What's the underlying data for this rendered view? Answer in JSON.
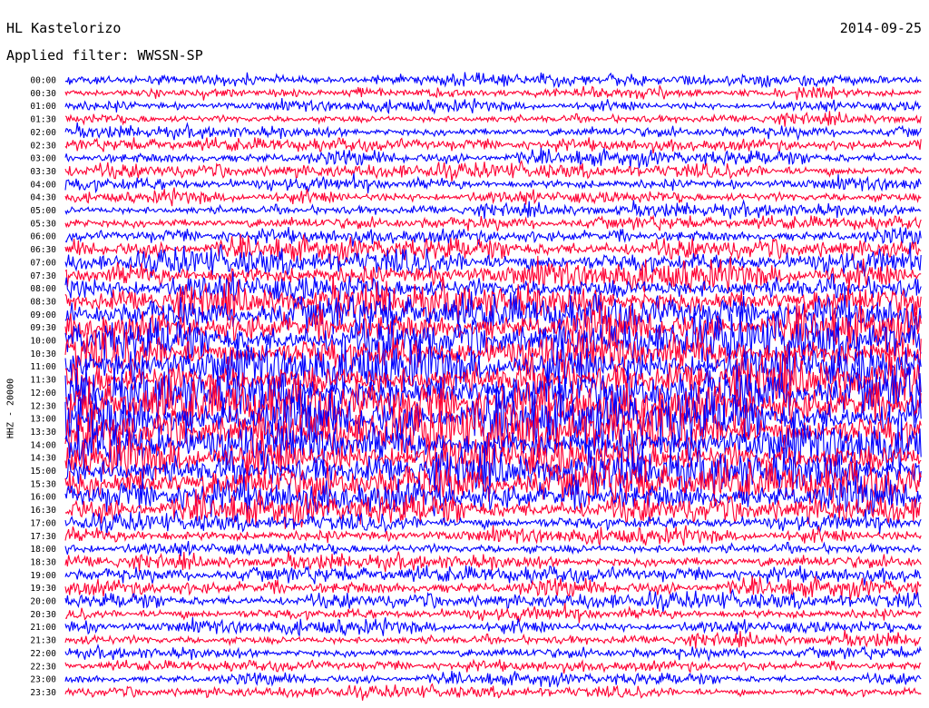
{
  "header": {
    "station": "HL Kastelorizo",
    "date": "2014-09-25",
    "filter": "Applied filter: WWSSN-SP"
  },
  "chart_data": {
    "type": "line",
    "title": "HL Kastelorizo",
    "ylabel": "HHZ - 20000",
    "colors": [
      "#0000ff",
      "#ff0033"
    ],
    "rows": [
      {
        "label": "00:00",
        "amplitude": 0.4
      },
      {
        "label": "00:30",
        "amplitude": 0.4
      },
      {
        "label": "01:00",
        "amplitude": 0.4
      },
      {
        "label": "01:30",
        "amplitude": 0.4
      },
      {
        "label": "02:00",
        "amplitude": 0.4
      },
      {
        "label": "02:30",
        "amplitude": 0.45
      },
      {
        "label": "03:00",
        "amplitude": 0.5
      },
      {
        "label": "03:30",
        "amplitude": 0.5
      },
      {
        "label": "04:00",
        "amplitude": 0.5
      },
      {
        "label": "04:30",
        "amplitude": 0.5
      },
      {
        "label": "05:00",
        "amplitude": 0.45
      },
      {
        "label": "05:30",
        "amplitude": 0.45
      },
      {
        "label": "06:00",
        "amplitude": 0.55
      },
      {
        "label": "06:30",
        "amplitude": 0.75
      },
      {
        "label": "07:00",
        "amplitude": 0.9
      },
      {
        "label": "07:30",
        "amplitude": 1.0
      },
      {
        "label": "08:00",
        "amplitude": 1.1
      },
      {
        "label": "08:30",
        "amplitude": 1.2
      },
      {
        "label": "09:00",
        "amplitude": 1.3
      },
      {
        "label": "09:30",
        "amplitude": 1.4
      },
      {
        "label": "10:00",
        "amplitude": 1.5
      },
      {
        "label": "10:30",
        "amplitude": 1.6
      },
      {
        "label": "11:00",
        "amplitude": 1.7
      },
      {
        "label": "11:30",
        "amplitude": 1.7
      },
      {
        "label": "12:00",
        "amplitude": 1.8
      },
      {
        "label": "12:30",
        "amplitude": 1.8
      },
      {
        "label": "13:00",
        "amplitude": 1.8
      },
      {
        "label": "13:30",
        "amplitude": 1.7
      },
      {
        "label": "14:00",
        "amplitude": 1.7
      },
      {
        "label": "14:30",
        "amplitude": 1.6
      },
      {
        "label": "15:00",
        "amplitude": 1.5
      },
      {
        "label": "15:30",
        "amplitude": 1.4
      },
      {
        "label": "16:00",
        "amplitude": 1.3
      },
      {
        "label": "16:30",
        "amplitude": 1.0
      },
      {
        "label": "17:00",
        "amplitude": 0.6
      },
      {
        "label": "17:30",
        "amplitude": 0.55
      },
      {
        "label": "18:00",
        "amplitude": 0.5
      },
      {
        "label": "18:30",
        "amplitude": 0.5
      },
      {
        "label": "19:00",
        "amplitude": 0.55
      },
      {
        "label": "19:30",
        "amplitude": 0.6
      },
      {
        "label": "20:00",
        "amplitude": 0.55
      },
      {
        "label": "20:30",
        "amplitude": 0.5
      },
      {
        "label": "21:00",
        "amplitude": 0.5
      },
      {
        "label": "21:30",
        "amplitude": 0.45
      },
      {
        "label": "22:00",
        "amplitude": 0.4
      },
      {
        "label": "22:30",
        "amplitude": 0.4
      },
      {
        "label": "23:00",
        "amplitude": 0.4
      },
      {
        "label": "23:30",
        "amplitude": 0.4
      }
    ]
  }
}
